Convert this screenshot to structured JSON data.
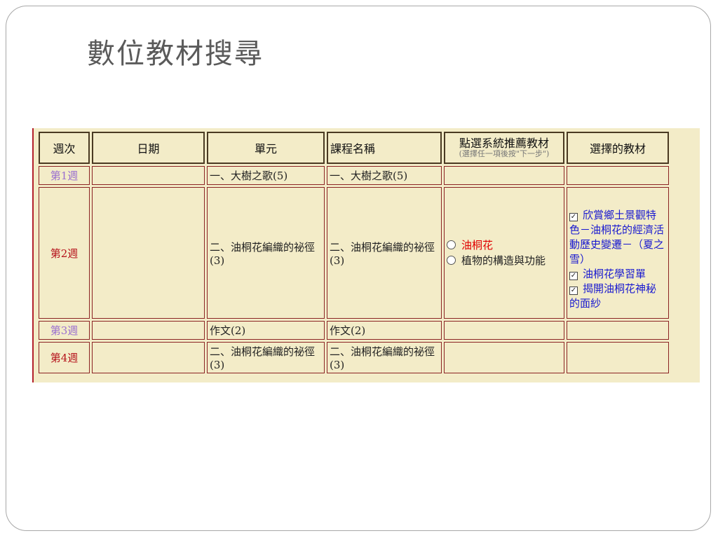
{
  "slide": {
    "title": "數位教材搜尋"
  },
  "table": {
    "headers": {
      "week": "週次",
      "date": "日期",
      "unit": "單元",
      "course": "課程名稱",
      "recommend_main": "點選系統推薦教材",
      "recommend_sub": "(選擇任一項後按\"下一步\")",
      "selected": "選擇的教材"
    },
    "rows": [
      {
        "week": "第1週",
        "date": "",
        "unit": "一、大樹之歌(5)",
        "course": "一、大樹之歌(5)"
      },
      {
        "week": "第2週",
        "date": "",
        "unit": "二、油桐花編織的祕徑(3)",
        "course": "二、油桐花編織的祕徑(3)",
        "options": [
          "油桐花",
          "植物的構造與功能"
        ],
        "selected": [
          "欣賞鄉土景觀特色－油桐花的經濟活動歷史變遷－（夏之雪）",
          "油桐花學習單",
          "揭開油桐花神秘的面紗"
        ]
      },
      {
        "week": "第3週",
        "date": "",
        "unit": "作文(2)",
        "course": "作文(2)"
      },
      {
        "week": "第4週",
        "date": "",
        "unit": "二、油桐花編織的祕徑(3)",
        "course": "二、油桐花編織的祕徑(3)"
      }
    ],
    "colors": {
      "odd_week": "#9a6fd0",
      "even_week": "#b5121b",
      "selected_text": "#1a1ad0",
      "option_highlight": "#e00000",
      "background": "#f3ecc8"
    },
    "icons": {
      "radio": "radio-button-icon",
      "check": "checkbox-checked-icon"
    }
  }
}
